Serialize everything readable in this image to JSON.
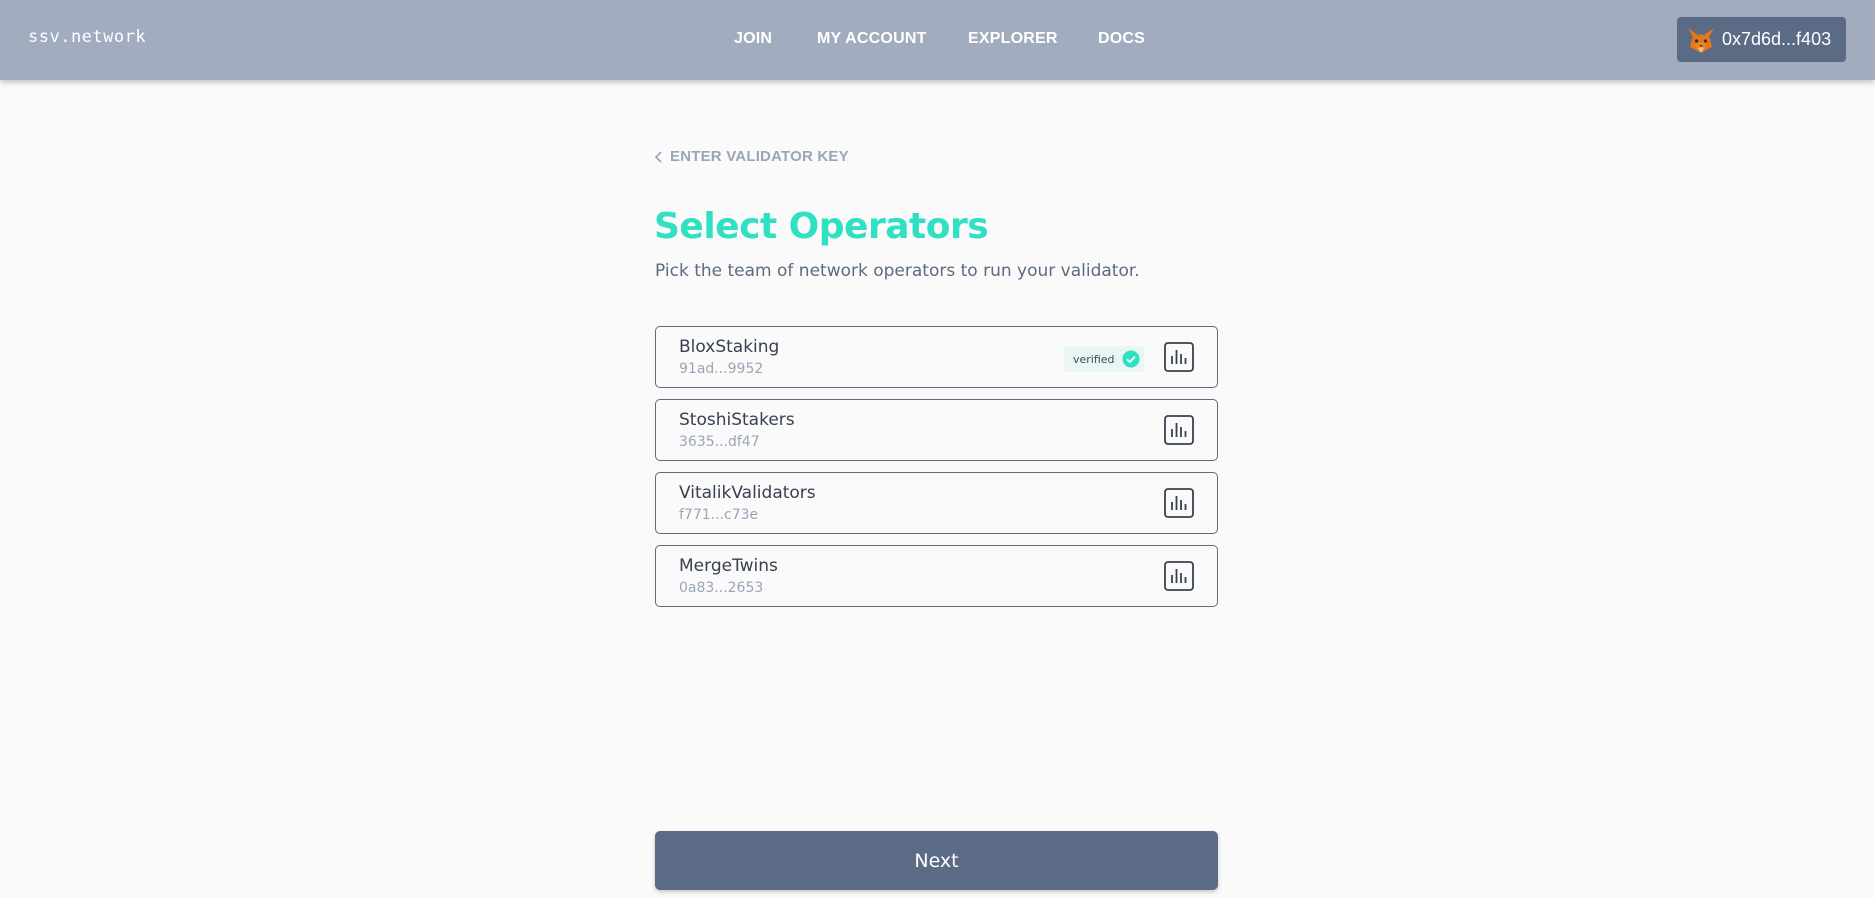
{
  "header": {
    "brand": "ssv.network",
    "nav": [
      {
        "label": "JOIN"
      },
      {
        "label": "MY ACCOUNT"
      },
      {
        "label": "EXPLORER"
      },
      {
        "label": "DOCS"
      }
    ],
    "wallet": {
      "address": "0x7d6d...f403",
      "icon": "metamask-fox-icon"
    }
  },
  "main": {
    "back_label": "ENTER VALIDATOR KEY",
    "title": "Select Operators",
    "subtitle": "Pick the team of network operators to run your validator.",
    "operators": [
      {
        "name": "BloxStaking",
        "key": "91ad...9952",
        "badge": "verified"
      },
      {
        "name": "StoshiStakers",
        "key": "3635...df47"
      },
      {
        "name": "VitalikValidators",
        "key": "f771...c73e"
      },
      {
        "name": "MergeTwins",
        "key": "0a83...2653"
      }
    ],
    "next_label": "Next"
  },
  "colors": {
    "header_bg": "#a1acbf",
    "accent": "#2fe0c3",
    "button_bg": "#5b6a85",
    "page_bg": "#fafafa"
  }
}
